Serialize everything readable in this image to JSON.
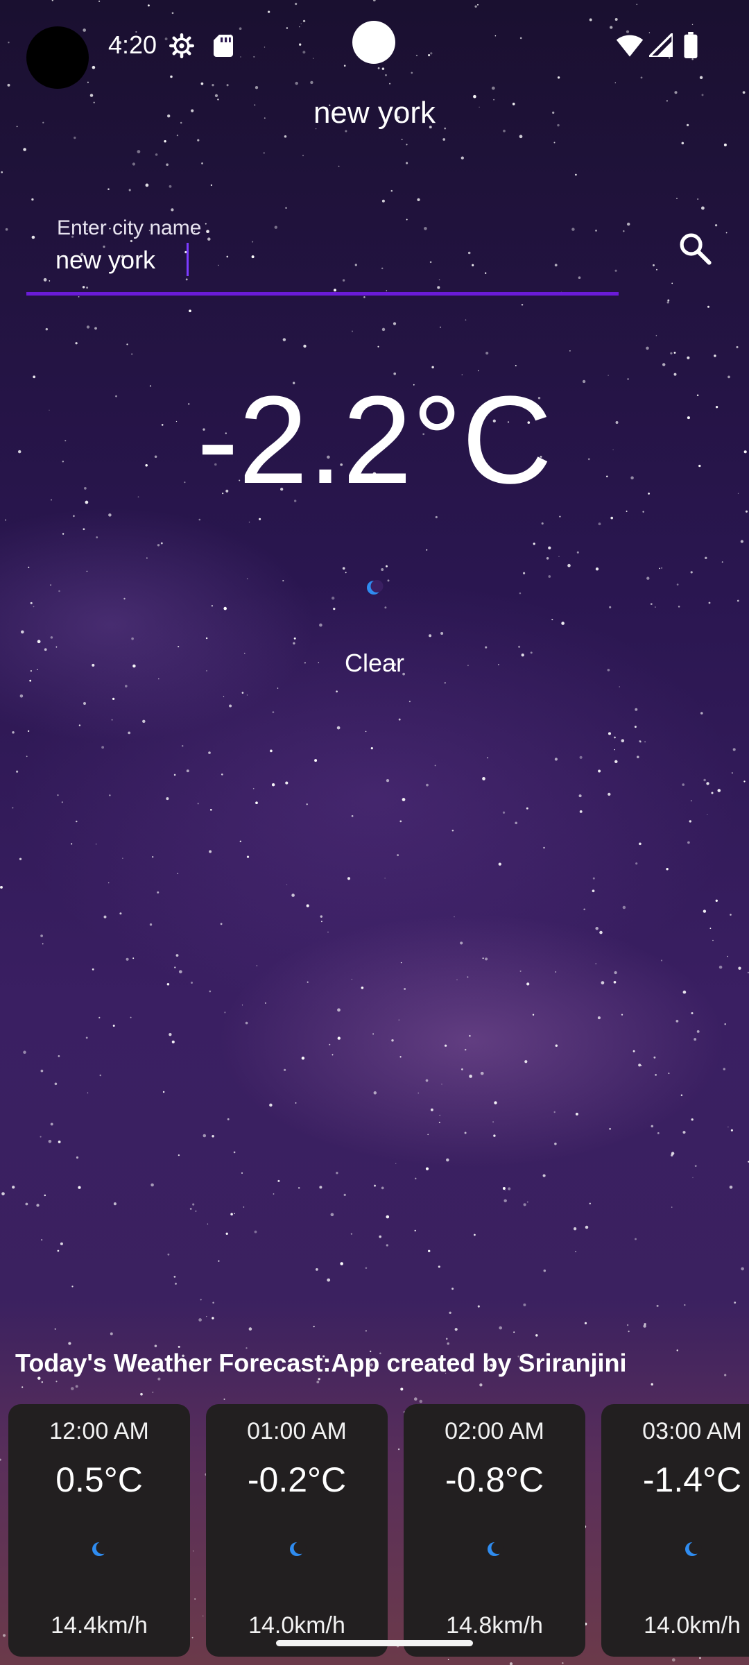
{
  "status_bar": {
    "time": "4:20"
  },
  "header": {
    "city_title": "new york"
  },
  "search": {
    "label": "Enter city name",
    "value": "new york",
    "accent_color": "#6a1bd8"
  },
  "current": {
    "temperature": "-2.2°C",
    "condition": "Clear",
    "icon": "crescent-moon-icon"
  },
  "forecast": {
    "heading": "Today's Weather Forecast:App created by Sriranjini",
    "items": [
      {
        "time": "12:00 AM",
        "temp": "0.5°C",
        "icon": "crescent-moon-icon",
        "wind": "14.4km/h"
      },
      {
        "time": "01:00 AM",
        "temp": "-0.2°C",
        "icon": "crescent-moon-icon",
        "wind": "14.0km/h"
      },
      {
        "time": "02:00 AM",
        "temp": "-0.8°C",
        "icon": "crescent-moon-icon",
        "wind": "14.8km/h"
      },
      {
        "time": "03:00 AM",
        "temp": "-1.4°C",
        "icon": "crescent-moon-icon",
        "wind": "14.0km/h"
      }
    ]
  }
}
